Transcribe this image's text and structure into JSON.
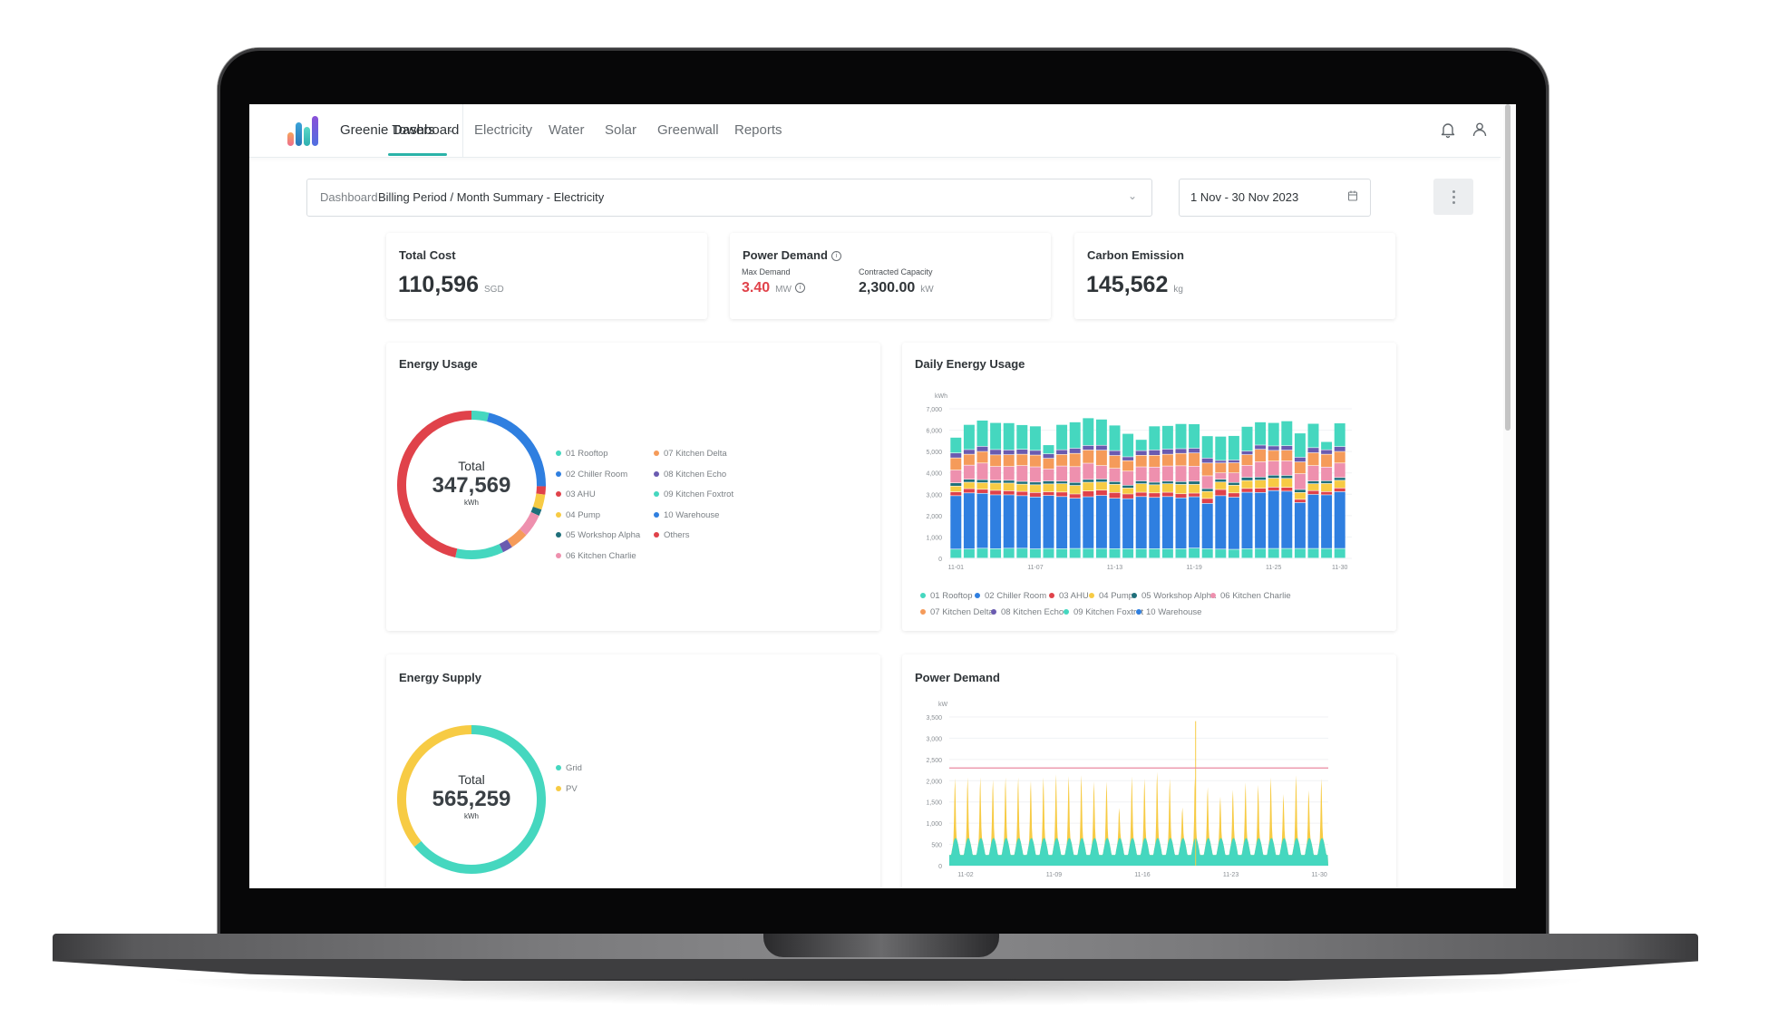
{
  "app": {
    "brand_name": "Greenie Towers",
    "tabs": [
      {
        "label": "Dashboard",
        "active": true
      },
      {
        "label": "Electricity",
        "active": false
      },
      {
        "label": "Water",
        "active": false
      },
      {
        "label": "Solar",
        "active": false
      },
      {
        "label": "Greenwall",
        "active": false
      },
      {
        "label": "Reports",
        "active": false
      }
    ],
    "icons": {
      "notifications": "bell-icon",
      "profile": "user-icon",
      "brand_dropdown": "chevron-down-icon"
    }
  },
  "toolbar": {
    "dashboard_prefix": "Dashboard",
    "dashboard_value": "Billing Period / Month Summary - Electricity",
    "date_range": "1 Nov - 30 Nov 2023",
    "more_menu_icon": "vertical-dots-icon",
    "calendar_icon": "calendar-icon"
  },
  "kpis": {
    "total_cost": {
      "title": "Total Cost",
      "value": "110,596",
      "unit": "SGD"
    },
    "power_demand": {
      "title": "Power Demand",
      "max_demand_label": "Max Demand",
      "max_demand_value": "3.40",
      "max_demand_unit": "MW",
      "contracted_label": "Contracted Capacity",
      "contracted_value": "2,300.00",
      "contracted_unit": "kW"
    },
    "carbon_emission": {
      "title": "Carbon Emission",
      "value": "145,562",
      "unit": "kg"
    }
  },
  "colors": {
    "teal": "#45d7bf",
    "blue": "#2f7fe0",
    "red": "#e0424a",
    "yellow": "#f7cb44",
    "darkteal": "#1f6f7a",
    "pink": "#ee90ae",
    "orange": "#f59b5a",
    "purple": "#6a5bb0",
    "accent": "#2bb3a8",
    "limit_line": "#ea8aa0"
  },
  "chart_data": [
    {
      "id": "energy_usage",
      "type": "pie",
      "title": "Energy Usage",
      "center_label": "Total",
      "center_value": "347,569",
      "center_unit": "kWh",
      "legend_placement": "right",
      "slices": [
        {
          "name": "09 Kitchen Foxtrot",
          "color": "#45d7bf",
          "percent": 3.8
        },
        {
          "name": "02 Chiller Room",
          "color": "#2f7fe0",
          "percent": 21.5
        },
        {
          "name": "03 AHU",
          "color": "#e0424a",
          "percent": 1.8
        },
        {
          "name": "04 Pump",
          "color": "#f7cb44",
          "percent": 3.3
        },
        {
          "name": "05 Workshop Alpha",
          "color": "#1f6f7a",
          "percent": 1.4
        },
        {
          "name": "06 Kitchen Charlie",
          "color": "#ee90ae",
          "percent": 5.0
        },
        {
          "name": "07 Kitchen Delta",
          "color": "#f59b5a",
          "percent": 4.0
        },
        {
          "name": "08 Kitchen Echo",
          "color": "#6a5bb0",
          "percent": 2.2
        },
        {
          "name": "01 Rooftop",
          "color": "#45d7bf",
          "percent": 10.5
        },
        {
          "name": "Others",
          "color": "#e0424a",
          "percent": 46.5
        }
      ],
      "legend": [
        {
          "label": "01 Rooftop",
          "color": "#45d7bf"
        },
        {
          "label": "02 Chiller Room",
          "color": "#2f7fe0"
        },
        {
          "label": "03 AHU",
          "color": "#e0424a"
        },
        {
          "label": "04 Pump",
          "color": "#f7cb44"
        },
        {
          "label": "05 Workshop Alpha",
          "color": "#1f6f7a"
        },
        {
          "label": "06 Kitchen Charlie",
          "color": "#ee90ae"
        },
        {
          "label": "07 Kitchen Delta",
          "color": "#f59b5a"
        },
        {
          "label": "08 Kitchen Echo",
          "color": "#6a5bb0"
        },
        {
          "label": "09 Kitchen Foxtrot",
          "color": "#45d7bf"
        },
        {
          "label": "10 Warehouse",
          "color": "#2f7fe0"
        },
        {
          "label": "Others",
          "color": "#e0424a"
        }
      ]
    },
    {
      "id": "daily_energy_usage",
      "type": "bar",
      "stacked": true,
      "title": "Daily Energy Usage",
      "ylabel": "kWh",
      "ylim": [
        0,
        7000
      ],
      "yticks": [
        "0",
        "1,000",
        "2,000",
        "3,000",
        "4,000",
        "5,000",
        "6,000",
        "7,000"
      ],
      "xtick_labels": [
        {
          "index": 0,
          "label": "11-01"
        },
        {
          "index": 6,
          "label": "11-07"
        },
        {
          "index": 12,
          "label": "11-13"
        },
        {
          "index": 18,
          "label": "11-19"
        },
        {
          "index": 24,
          "label": "11-25"
        },
        {
          "index": 29,
          "label": "11-30"
        }
      ],
      "categories": [
        "11-01",
        "11-02",
        "11-03",
        "11-04",
        "11-05",
        "11-06",
        "11-07",
        "11-08",
        "11-09",
        "11-10",
        "11-11",
        "11-12",
        "11-13",
        "11-14",
        "11-15",
        "11-16",
        "11-17",
        "11-18",
        "11-19",
        "11-20",
        "11-21",
        "11-22",
        "11-23",
        "11-24",
        "11-25",
        "11-26",
        "11-27",
        "11-28",
        "11-29",
        "11-30"
      ],
      "grid": true,
      "legend_placement": "bottom",
      "series": [
        {
          "name": "01 Rooftop",
          "color": "#45d7bf",
          "values": [
            420,
            430,
            460,
            440,
            460,
            460,
            430,
            450,
            440,
            450,
            450,
            450,
            440,
            440,
            440,
            440,
            440,
            440,
            470,
            440,
            420,
            410,
            440,
            450,
            450,
            450,
            450,
            450,
            450,
            450
          ]
        },
        {
          "name": "02 Chiller Room",
          "color": "#2f7fe0",
          "values": [
            2500,
            2620,
            2570,
            2520,
            2500,
            2460,
            2430,
            2480,
            2440,
            2350,
            2420,
            2480,
            2360,
            2340,
            2440,
            2400,
            2440,
            2380,
            2400,
            2120,
            2500,
            2440,
            2640,
            2620,
            2710,
            2680,
            2150,
            2530,
            2510,
            2660
          ]
        },
        {
          "name": "03 AHU",
          "color": "#e0424a",
          "values": [
            180,
            200,
            190,
            210,
            190,
            200,
            210,
            170,
            210,
            200,
            270,
            250,
            270,
            220,
            200,
            210,
            200,
            190,
            170,
            230,
            290,
            200,
            180,
            200,
            160,
            180,
            150,
            180,
            150,
            170
          ]
        },
        {
          "name": "04 Pump",
          "color": "#f7cb44",
          "values": [
            270,
            300,
            310,
            340,
            360,
            340,
            360,
            370,
            390,
            400,
            410,
            380,
            380,
            280,
            400,
            380,
            400,
            440,
            410,
            330,
            350,
            360,
            370,
            380,
            420,
            420,
            320,
            320,
            380,
            360
          ]
        },
        {
          "name": "05 Workshop Alpha",
          "color": "#1f6f7a",
          "values": [
            150,
            140,
            140,
            130,
            130,
            130,
            130,
            140,
            120,
            140,
            130,
            140,
            130,
            130,
            130,
            120,
            120,
            130,
            150,
            130,
            130,
            130,
            150,
            140,
            140,
            140,
            140,
            130,
            130,
            130
          ]
        },
        {
          "name": "06 Kitchen Charlie",
          "color": "#ee90ae",
          "values": [
            600,
            660,
            780,
            650,
            650,
            740,
            710,
            560,
            710,
            740,
            760,
            630,
            620,
            660,
            660,
            710,
            710,
            740,
            700,
            600,
            300,
            450,
            560,
            720,
            660,
            680,
            740,
            720,
            640,
            680
          ]
        },
        {
          "name": "07 Kitchen Delta",
          "color": "#f59b5a",
          "values": [
            570,
            510,
            540,
            540,
            550,
            530,
            550,
            500,
            540,
            620,
            620,
            720,
            600,
            490,
            540,
            550,
            550,
            580,
            620,
            600,
            460,
            470,
            500,
            580,
            500,
            500,
            550,
            600,
            600,
            540
          ]
        },
        {
          "name": "08 Kitchen Echo",
          "color": "#6a5bb0",
          "values": [
            230,
            220,
            240,
            250,
            220,
            230,
            220,
            210,
            220,
            240,
            210,
            230,
            230,
            180,
            220,
            250,
            240,
            220,
            220,
            230,
            120,
            130,
            170,
            200,
            210,
            210,
            220,
            240,
            210,
            230
          ]
        },
        {
          "name": "09 Kitchen Foxtrot",
          "color": "#45d7bf",
          "values": [
            730,
            1170,
            1220,
            1260,
            1270,
            1150,
            1140,
            420,
            1180,
            1230,
            1290,
            1220,
            1190,
            1090,
            520,
            1120,
            1100,
            1170,
            1140,
            1040,
            1130,
            1140,
            1150,
            1080,
            1090,
            1160,
            1130,
            1130,
            380,
            1100
          ]
        }
      ],
      "legend": [
        {
          "label": "01 Rooftop",
          "color": "#45d7bf"
        },
        {
          "label": "02 Chiller Room",
          "color": "#2f7fe0"
        },
        {
          "label": "03 AHU",
          "color": "#e0424a"
        },
        {
          "label": "04 Pump",
          "color": "#f7cb44"
        },
        {
          "label": "05 Workshop Alpha",
          "color": "#1f6f7a"
        },
        {
          "label": "06 Kitchen Charlie",
          "color": "#ee90ae"
        },
        {
          "label": "07 Kitchen Delta",
          "color": "#f59b5a"
        },
        {
          "label": "08 Kitchen Echo",
          "color": "#6a5bb0"
        },
        {
          "label": "09 Kitchen Foxtrot",
          "color": "#45d7bf"
        },
        {
          "label": "10 Warehouse",
          "color": "#2f7fe0"
        }
      ]
    },
    {
      "id": "energy_supply",
      "type": "pie",
      "title": "Energy Supply",
      "center_label": "Total",
      "center_value": "565,259",
      "center_unit": "kWh",
      "legend_placement": "right",
      "slices": [
        {
          "name": "Grid",
          "color": "#45d7bf",
          "percent": 64
        },
        {
          "name": "PV",
          "color": "#f7cb44",
          "percent": 36
        }
      ],
      "legend": [
        {
          "label": "Grid",
          "color": "#45d7bf"
        },
        {
          "label": "PV",
          "color": "#f7cb44"
        }
      ]
    },
    {
      "id": "power_demand",
      "type": "area",
      "title": "Power Demand",
      "ylabel": "kW",
      "ylim": [
        0,
        3500
      ],
      "yticks": [
        "0",
        "500",
        "1,000",
        "1,500",
        "2,000",
        "2,500",
        "3,000",
        "3,500"
      ],
      "xtick_labels": [
        "11-02",
        "11-09",
        "11-16",
        "11-23",
        "11-30"
      ],
      "x_range_days": [
        1,
        30
      ],
      "grid": true,
      "contracted_capacity_line": 2300,
      "series": [
        {
          "name": "Grid",
          "color": "#45d7bf",
          "daily_base_kw": 250,
          "daily_peak_kw": 650
        },
        {
          "name": "PV",
          "color": "#f7cb44",
          "daily_peak_kw": [
            2080,
            2100,
            2100,
            2040,
            2100,
            2100,
            2020,
            2100,
            2170,
            2130,
            2150,
            2000,
            2000,
            1370,
            2120,
            2070,
            2230,
            2070,
            1380,
            2120,
            1870,
            1640,
            1800,
            1980,
            1920,
            2100,
            1700,
            2150,
            1790,
            2070
          ],
          "spike": {
            "day": 20,
            "value_kw": 3400
          }
        }
      ]
    }
  ]
}
